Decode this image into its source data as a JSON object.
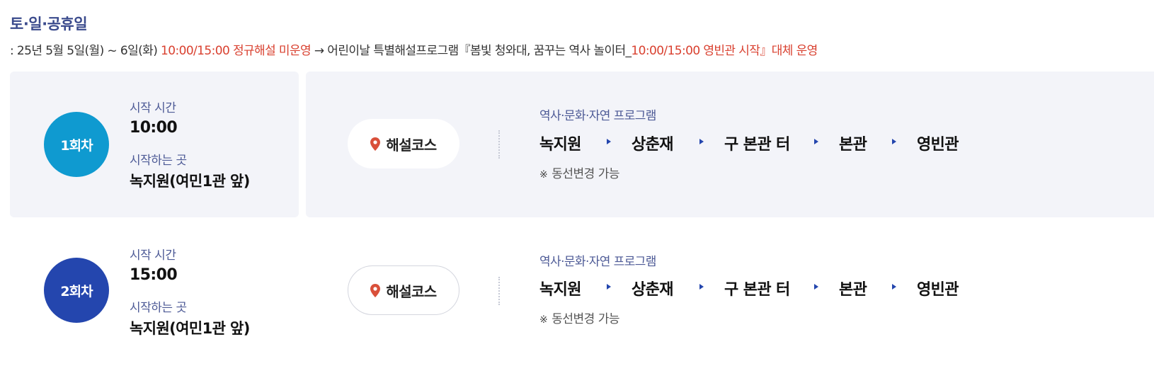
{
  "heading": "토·일·공휴일",
  "notice": {
    "prefix": ": 25년 5월 5일(월) ~ 6일(화) ",
    "red1": "10:00/15:00 정규해설 미운영",
    "middle": " → 어린이날 특별해설프로그램『봄빛 청와대, 꿈꾸는 역사 놀이터_",
    "red2": "10:00/15:00 영빈관 시작』대체 운영"
  },
  "sessions": [
    {
      "badge": "1회차",
      "start_time_label": "시작 시간",
      "start_time": "10:00",
      "start_place_label": "시작하는 곳",
      "start_place": "녹지원(여민1관 앞)",
      "course_button": "해설코스",
      "program_title": "역사·문화·자연 프로그램",
      "route": [
        "녹지원",
        "상춘재",
        "구 본관 터",
        "본관",
        "영빈관"
      ],
      "note_mark": "※",
      "note": "동선변경 가능"
    },
    {
      "badge": "2회차",
      "start_time_label": "시작 시간",
      "start_time": "15:00",
      "start_place_label": "시작하는 곳",
      "start_place": "녹지원(여민1관 앞)",
      "course_button": "해설코스",
      "program_title": "역사·문화·자연 프로그램",
      "route": [
        "녹지원",
        "상춘재",
        "구 본관 터",
        "본관",
        "영빈관"
      ],
      "note_mark": "※",
      "note": "동선변경 가능"
    }
  ],
  "colors": {
    "heading": "#3a4a8c",
    "highlight_red": "#d9402f",
    "badge_1": "#0f9ad0",
    "badge_2": "#2446ae",
    "label": "#4d5a96",
    "pin": "#d9503a",
    "panel_bg": "#f3f4f9"
  },
  "icons": {
    "pin": "map-pin-icon",
    "route_arrow": "triangle-right-icon"
  }
}
